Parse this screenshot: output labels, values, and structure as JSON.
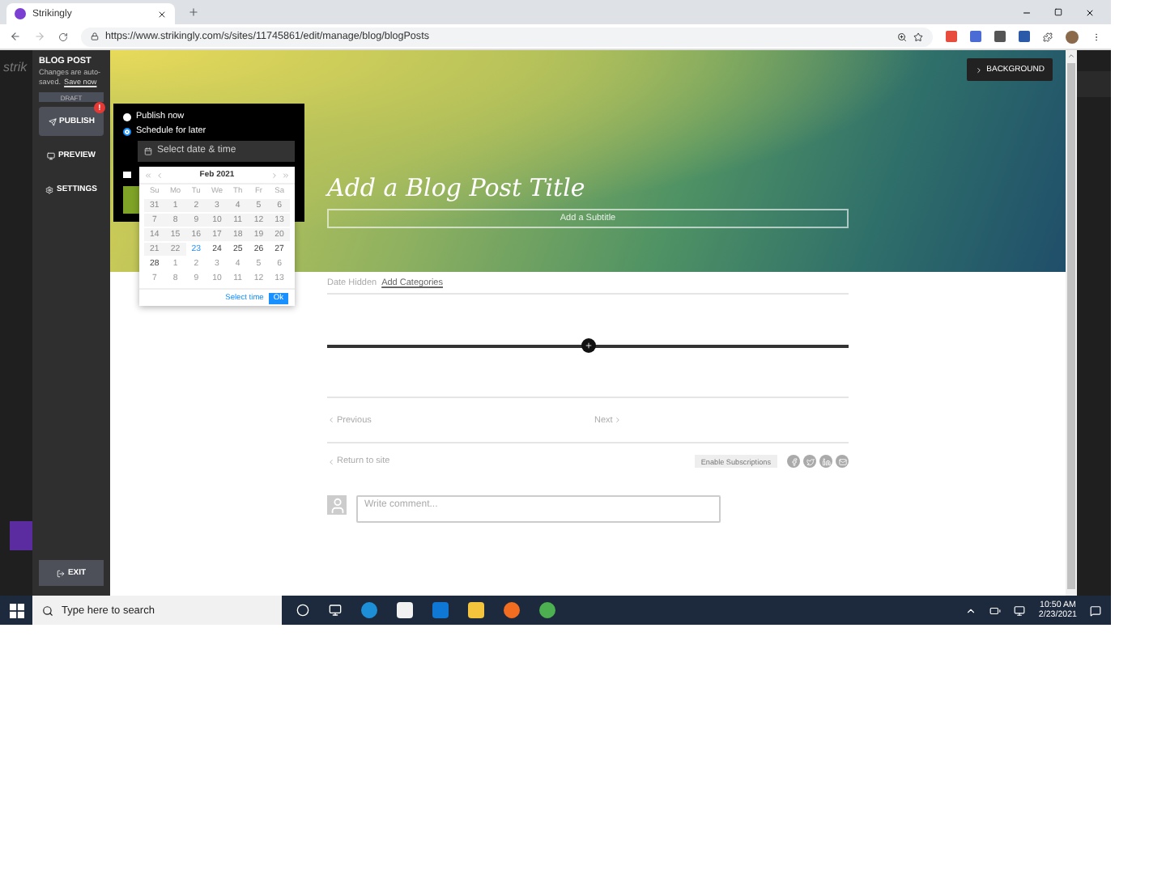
{
  "browser": {
    "tab": {
      "title": "Strikingly"
    },
    "url": "https://www.strikingly.com/s/sites/11745861/edit/manage/blog/blogPosts"
  },
  "editor_background": {
    "logo": "strik"
  },
  "sidebar": {
    "title": "BLOG POST",
    "note": "Changes are auto-saved.",
    "save_link": "Save now",
    "status": "DRAFT",
    "exit": "EXIT",
    "items": [
      {
        "kind": "publish",
        "label": "PUBLISH",
        "selected": true,
        "alert": "!"
      },
      {
        "kind": "preview",
        "label": "PREVIEW",
        "selected": false
      },
      {
        "kind": "settings",
        "label": "SETTINGS",
        "selected": false
      }
    ]
  },
  "publish_popover": {
    "options": [
      {
        "label": "Publish now",
        "selected": false
      },
      {
        "label": "Schedule for later",
        "selected": true
      }
    ],
    "date_field": {
      "placeholder": "Select date & time"
    },
    "checkbox": {
      "checked": false
    }
  },
  "calendar": {
    "month": "Feb 2021",
    "weekdays": [
      "Su",
      "Mo",
      "Tu",
      "We",
      "Th",
      "Fr",
      "Sa"
    ],
    "select_time": "Select time",
    "ok": "Ok",
    "days": [
      {
        "label": "31",
        "kind": "disabled"
      },
      {
        "label": "1",
        "kind": "disabled"
      },
      {
        "label": "2",
        "kind": "disabled"
      },
      {
        "label": "3",
        "kind": "disabled"
      },
      {
        "label": "4",
        "kind": "disabled"
      },
      {
        "label": "5",
        "kind": "disabled"
      },
      {
        "label": "6",
        "kind": "disabled"
      },
      {
        "label": "7",
        "kind": "disabled"
      },
      {
        "label": "8",
        "kind": "disabled"
      },
      {
        "label": "9",
        "kind": "disabled"
      },
      {
        "label": "10",
        "kind": "disabled"
      },
      {
        "label": "11",
        "kind": "disabled"
      },
      {
        "label": "12",
        "kind": "disabled"
      },
      {
        "label": "13",
        "kind": "disabled"
      },
      {
        "label": "14",
        "kind": "disabled"
      },
      {
        "label": "15",
        "kind": "disabled"
      },
      {
        "label": "16",
        "kind": "disabled"
      },
      {
        "label": "17",
        "kind": "disabled"
      },
      {
        "label": "18",
        "kind": "disabled"
      },
      {
        "label": "19",
        "kind": "disabled"
      },
      {
        "label": "20",
        "kind": "disabled"
      },
      {
        "label": "21",
        "kind": "disabled"
      },
      {
        "label": "22",
        "kind": "disabled"
      },
      {
        "label": "23",
        "kind": "today"
      },
      {
        "label": "24",
        "kind": "normal"
      },
      {
        "label": "25",
        "kind": "normal"
      },
      {
        "label": "26",
        "kind": "normal"
      },
      {
        "label": "27",
        "kind": "normal"
      },
      {
        "label": "28",
        "kind": "normal"
      },
      {
        "label": "1",
        "kind": "outside"
      },
      {
        "label": "2",
        "kind": "outside"
      },
      {
        "label": "3",
        "kind": "outside"
      },
      {
        "label": "4",
        "kind": "outside"
      },
      {
        "label": "5",
        "kind": "outside"
      },
      {
        "label": "6",
        "kind": "outside"
      },
      {
        "label": "7",
        "kind": "outside"
      },
      {
        "label": "8",
        "kind": "outside"
      },
      {
        "label": "9",
        "kind": "outside"
      },
      {
        "label": "10",
        "kind": "outside"
      },
      {
        "label": "11",
        "kind": "outside"
      },
      {
        "label": "12",
        "kind": "outside"
      },
      {
        "label": "13",
        "kind": "outside"
      }
    ]
  },
  "hero": {
    "background_button": "BACKGROUND",
    "title": "Add a Blog Post Title",
    "subtitle": {
      "placeholder": "Add a Subtitle"
    }
  },
  "post": {
    "date": "Date Hidden",
    "categories_link": "Add Categories",
    "previous": "Previous",
    "next": "Next",
    "return_link": "Return to site",
    "subscribe_button": "Enable Subscriptions",
    "comment": {
      "placeholder": "Write comment..."
    }
  },
  "taskbar": {
    "search": {
      "placeholder": "Type here to search"
    },
    "time": "10:50 AM",
    "date": "2/23/2021"
  }
}
